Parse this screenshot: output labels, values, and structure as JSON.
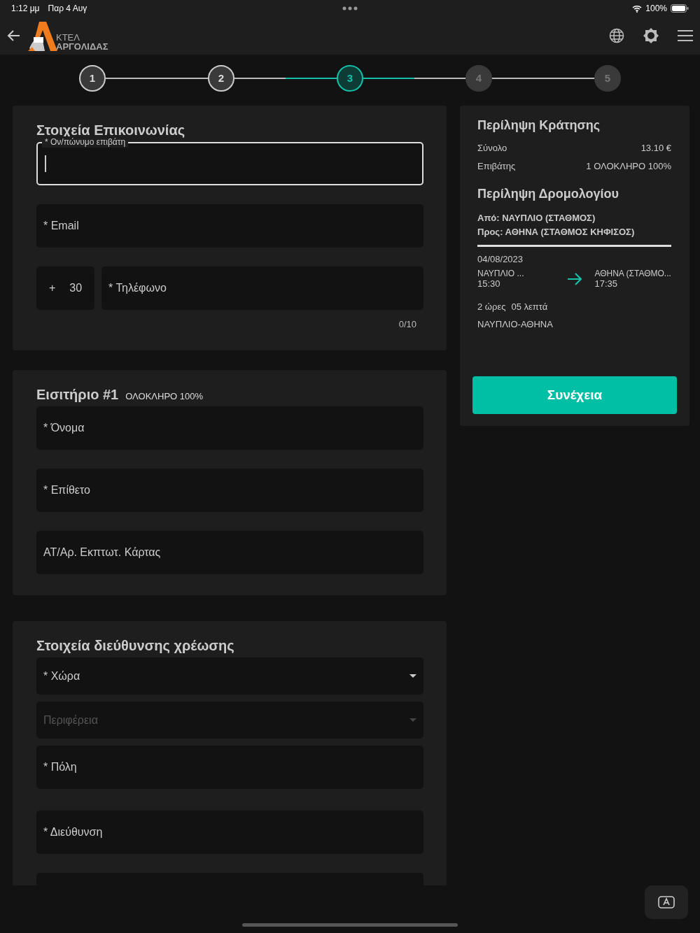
{
  "status_bar": {
    "time": "1:12 μμ",
    "date": "Παρ 4 Αυγ",
    "battery": "100%"
  },
  "header": {
    "logo_top": "ΚΤΕΛ",
    "logo_bottom": "ΑΡΓΟΛΙΔΑΣ"
  },
  "stepper": [
    {
      "label": "1",
      "completed": true,
      "selected": false
    },
    {
      "label": "2",
      "completed": true,
      "selected": false
    },
    {
      "label": "3",
      "completed": false,
      "selected": true
    },
    {
      "label": "4",
      "completed": false,
      "selected": false
    },
    {
      "label": "5",
      "completed": false,
      "selected": false
    }
  ],
  "contact": {
    "title": "Στοιχεία Επικοινωνίας",
    "fields": [
      {
        "kind": "text",
        "label": "* Ον/πώνυμο επιβάτη",
        "focused": true
      },
      {
        "kind": "text",
        "label": "* Email",
        "focused": false
      },
      {
        "kind": "phone",
        "prefix": "+",
        "code": "30",
        "label": "* Τηλέφωνο",
        "counter": "0/10",
        "focused": false
      }
    ]
  },
  "ticket": {
    "title": "Εισιτήριο #1",
    "subtitle": "ΟΛΟΚΛΗΡΟ 100%",
    "fields": [
      {
        "kind": "text",
        "label": "* Όνομα",
        "focused": false
      },
      {
        "kind": "text",
        "label": "* Επίθετο",
        "focused": false
      },
      {
        "kind": "text",
        "label": "ΑΤ/Αρ. Εκπτωτ. Κάρτας",
        "focused": false
      }
    ]
  },
  "billing": {
    "title": "Στοιχεία διεύθυνσης χρέωσης",
    "fields": [
      {
        "kind": "select",
        "label": "* Χώρα",
        "disabled": false
      },
      {
        "kind": "select",
        "label": "Περιφέρεια",
        "disabled": true
      },
      {
        "kind": "text",
        "label": "* Πόλη",
        "focused": false
      },
      {
        "kind": "text",
        "label": "* Διεύθυνση",
        "focused": false
      },
      {
        "kind": "text",
        "focused": false
      }
    ]
  },
  "summary": {
    "title": "Περίληψη Κράτησης",
    "rows": [
      {
        "label": "Σύνολο",
        "value": "13.10 €"
      },
      {
        "label": "Επιβάτης",
        "value": "1 ΟΛΟΚΛΗΡΟ 100%"
      }
    ],
    "route_title": "Περίληψη Δρομολογίου",
    "from": "Από: ΝΑΥΠΛΙΟ (ΣΤΑΘΜΟΣ)",
    "to": "Προς: ΑΘΗΝΑ (ΣΤΑΘΜΟΣ ΚΗΦΙΣΟΣ)",
    "date": "04/08/2023",
    "departure": {
      "place": "ΝΑΥΠΛΙΟ ...",
      "time": "15:30"
    },
    "arrival": {
      "place": "ΑΘΗΝΑ (ΣΤΑΘΜΟ...",
      "time": "17:35"
    },
    "duration_hours": "2 ώρες",
    "duration_minutes": "05 λεπτά",
    "line": "ΝΑΥΠΛΙΟ-ΑΘΗΝΑ",
    "button": "Συνέχεια"
  }
}
